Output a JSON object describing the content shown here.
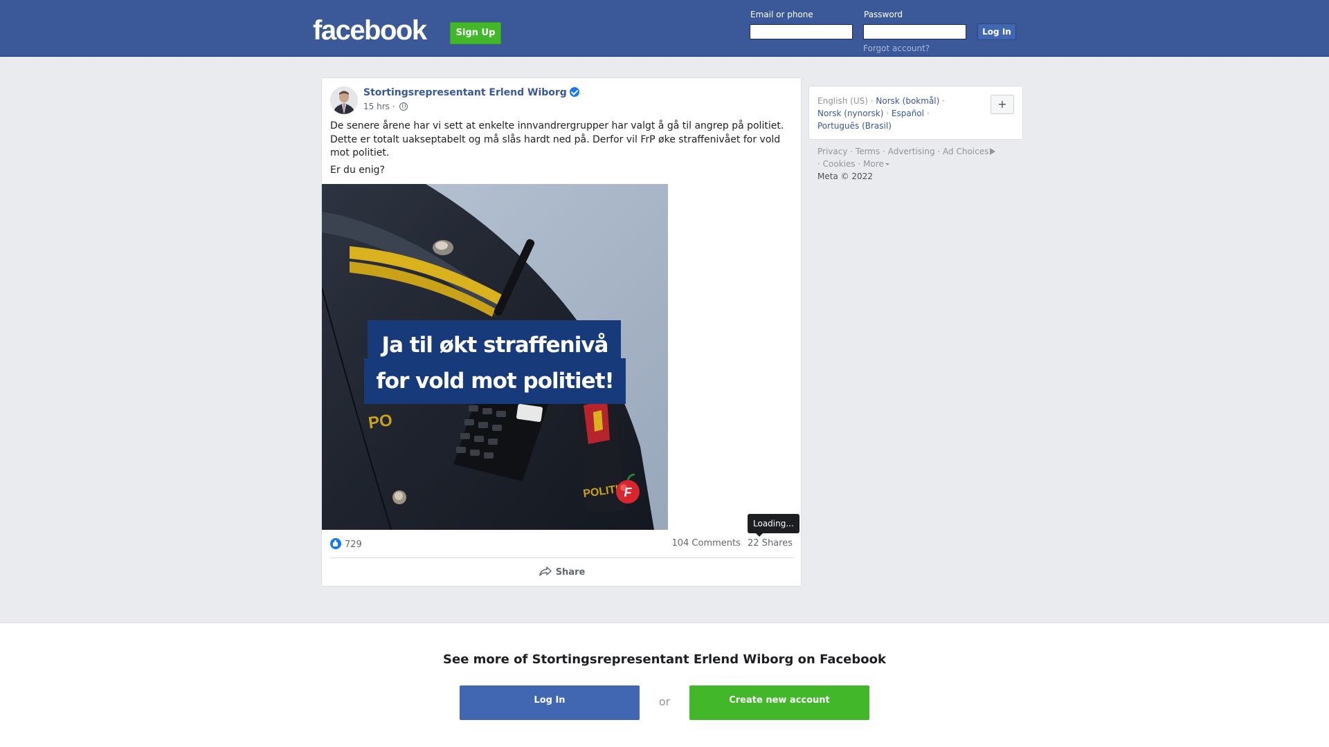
{
  "header": {
    "logo": "facebook",
    "signup_label": "Sign Up",
    "email_label": "Email or phone",
    "email_value": "",
    "password_label": "Password",
    "password_value": "",
    "login_label": "Log In",
    "forgot_label": "Forgot account?",
    "bar_color": "#3b5998"
  },
  "post": {
    "author": "Stortingsrepresentant Erlend Wiborg",
    "time": "15 hrs",
    "meta_separator": "·",
    "paragraphs": [
      "De senere årene har vi sett at enkelte innvandrergrupper har valgt å gå til angrep på politiet. Dette er totalt uakseptabelt og må slås hardt ned på. Derfor vil FrP øke straffenivået for vold mot politiet.",
      "Er du enig?"
    ],
    "image_text_line1": "Ja til økt straffenivå",
    "image_text_line2": "for vold mot politiet!",
    "image_patch_text": "POLITI",
    "image_sleeve_text": "PO",
    "image_party_logo": "F",
    "reaction_count": "729",
    "comments": "104 Comments",
    "shares": "22 Shares",
    "tooltip": "Loading...",
    "share_label": "Share"
  },
  "sidebar": {
    "current_language": "English (US)",
    "languages": [
      "Norsk (bokmål)",
      "Norsk (nynorsk)",
      "Español",
      "Português (Brasil)"
    ],
    "plus_label": "+",
    "footer": [
      "Privacy",
      "Terms",
      "Advertising",
      "Ad Choices",
      "Cookies",
      "More"
    ],
    "copyright": "Meta © 2022"
  },
  "banner": {
    "title": "See more of Stortingsrepresentant Erlend Wiborg on Facebook",
    "login_label": "Log In",
    "or_label": "or",
    "create_label": "Create new account"
  },
  "colors": {
    "brand_blue": "#3b5998",
    "button_blue": "#4267b2",
    "green": "#42b72a",
    "link": "#385898"
  }
}
